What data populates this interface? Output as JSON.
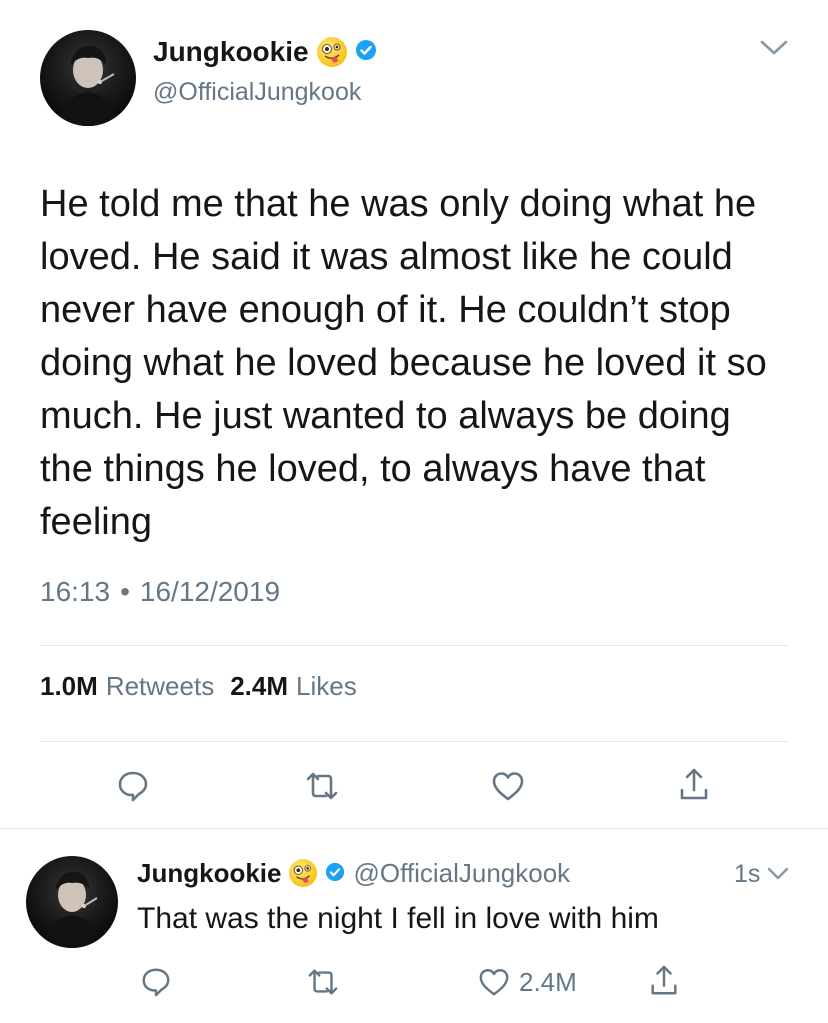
{
  "tweet": {
    "display_name": "Jungkookie",
    "handle": "@OfficialJungkook",
    "body": "He told me that he was only doing what he loved. He said it was almost like he could never have enough of it. He couldn’t stop doing what he loved because he loved it so much. He just wanted to always be doing the things he loved, to always have that feeling",
    "time": "16:13",
    "separator": "•",
    "date": "16/12/2019",
    "retweets_count": "1.0M",
    "retweets_label": "Retweets",
    "likes_count": "2.4M",
    "likes_label": "Likes",
    "icons": [
      "reply-icon",
      "retweet-icon",
      "like-icon",
      "share-icon"
    ]
  },
  "reply": {
    "display_name": "Jungkookie",
    "handle": "@OfficialJungkook",
    "age": "1s",
    "body": "That was the night I fell in love with him",
    "like_count": "2.4M",
    "icons": [
      "reply-icon",
      "retweet-icon",
      "like-icon",
      "share-icon"
    ]
  },
  "colors": {
    "verified": "#1da1f2",
    "text": "#14171a",
    "muted": "#657786",
    "divider": "#e1e8ed"
  }
}
